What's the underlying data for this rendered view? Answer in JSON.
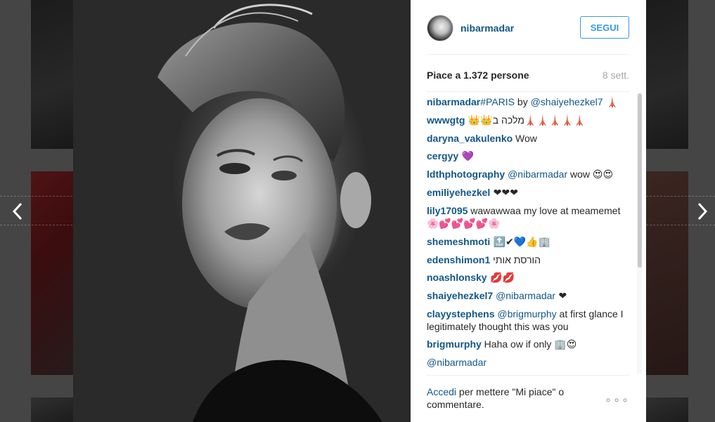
{
  "post": {
    "username": "nibarmadar",
    "follow_label": "SEGUI",
    "likes_prefix": "Piace a ",
    "likes_count": "1.372",
    "likes_suffix": " persone",
    "age": "8 sett.",
    "footer_login": "Accedi",
    "footer_text": " per mettere \"Mi piace\" o commentare.",
    "more_label": "∘∘∘"
  },
  "comments": [
    {
      "user": "nibarmadar",
      "parts": [
        {
          "t": "m",
          "v": "#PARIS"
        },
        {
          "t": "x",
          "v": " by "
        },
        {
          "t": "m",
          "v": "@shaiyehezkel7"
        },
        {
          "t": "e",
          "v": " 🗼"
        }
      ]
    },
    {
      "user": "wwwgtg",
      "parts": [
        {
          "t": "e",
          "v": " 👑👑"
        },
        {
          "t": "x",
          "v": "מלכה ב"
        },
        {
          "t": "e",
          "v": "🗼🗼🗼🗼🗼"
        }
      ]
    },
    {
      "user": "daryna_vakulenko",
      "parts": [
        {
          "t": "x",
          "v": " Wow"
        }
      ]
    },
    {
      "user": "cergyy",
      "parts": [
        {
          "t": "e",
          "v": " 💜"
        }
      ]
    },
    {
      "user": "ldthphotography",
      "parts": [
        {
          "t": "x",
          "v": " "
        },
        {
          "t": "m",
          "v": "@nibarmadar"
        },
        {
          "t": "x",
          "v": " wow "
        },
        {
          "t": "e",
          "v": "😍😍"
        }
      ]
    },
    {
      "user": "emiliyehezkel",
      "parts": [
        {
          "t": "e",
          "v": " ❤❤❤"
        }
      ]
    },
    {
      "user": "lily17095",
      "parts": [
        {
          "t": "x",
          "v": " wawawwaa my love at meamemet"
        },
        {
          "t": "e",
          "v": "🌸💕💕💕💕🌸"
        }
      ]
    },
    {
      "user": "shemeshmoti",
      "parts": [
        {
          "t": "e",
          "v": " 🔝✔💙👍🏢"
        }
      ]
    },
    {
      "user": "edenshimon1",
      "parts": [
        {
          "t": "x",
          "v": " הורסת אותי"
        }
      ]
    },
    {
      "user": "noashlonsky",
      "parts": [
        {
          "t": "e",
          "v": " 💋💋"
        }
      ]
    },
    {
      "user": "shaiyehezkel7",
      "parts": [
        {
          "t": "x",
          "v": " "
        },
        {
          "t": "m",
          "v": "@nibarmadar"
        },
        {
          "t": "e",
          "v": " ❤"
        }
      ]
    },
    {
      "user": "clayystephens",
      "parts": [
        {
          "t": "x",
          "v": " "
        },
        {
          "t": "m",
          "v": "@brigmurphy"
        },
        {
          "t": "x",
          "v": " at first glance I legitimately thought this was you"
        }
      ]
    },
    {
      "user": "brigmurphy",
      "parts": [
        {
          "t": "x",
          "v": " Haha ow if only "
        },
        {
          "t": "e",
          "v": "🏢😍"
        }
      ]
    },
    {
      "user": "",
      "parts": [
        {
          "t": "m",
          "v": "@nibarmadar"
        }
      ]
    }
  ],
  "colors": {
    "link": "#125688",
    "follow": "#3897f0",
    "muted": "#a5a7aa"
  },
  "icons": {
    "prev": "chevron-left-icon",
    "next": "chevron-right-icon"
  }
}
